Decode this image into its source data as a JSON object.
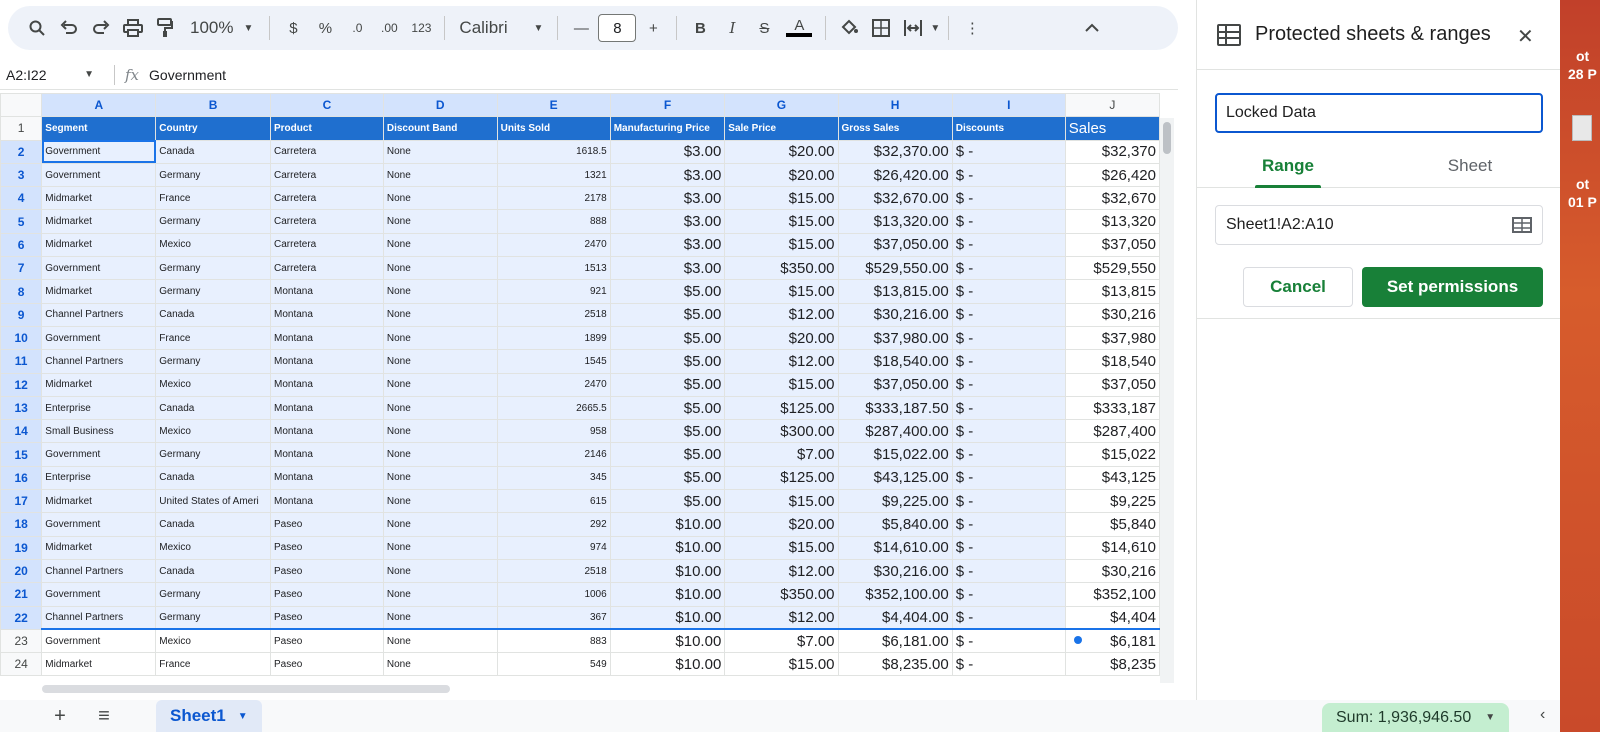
{
  "toolbar": {
    "zoom": "100%",
    "currency": "$",
    "percent": "%",
    "dec_decrease": ".0",
    "dec_increase": ".00",
    "number_format": "123",
    "font": "Calibri",
    "font_size": "8",
    "bold": "B",
    "italic": "I",
    "strike": "S",
    "text_color": "A"
  },
  "formula_bar": {
    "name_box": "A2:I22",
    "fx": "fx",
    "value": "Government"
  },
  "grid": {
    "columns": [
      "A",
      "B",
      "C",
      "D",
      "E",
      "F",
      "G",
      "H",
      "I",
      "J"
    ],
    "header_row": [
      "Segment",
      "Country",
      "Product",
      "Discount Band",
      "Units Sold",
      "Manufacturing Price",
      "Sale Price",
      "Gross Sales",
      "Discounts",
      "Sales"
    ],
    "rows": [
      {
        "n": "2",
        "c": [
          "Government",
          "Canada",
          "Carretera",
          "None",
          "1618.5",
          "$3.00",
          "$20.00",
          "$32,370.00",
          "$ -",
          "$32,370"
        ]
      },
      {
        "n": "3",
        "c": [
          "Government",
          "Germany",
          "Carretera",
          "None",
          "1321",
          "$3.00",
          "$20.00",
          "$26,420.00",
          "$ -",
          "$26,420"
        ]
      },
      {
        "n": "4",
        "c": [
          "Midmarket",
          "France",
          "Carretera",
          "None",
          "2178",
          "$3.00",
          "$15.00",
          "$32,670.00",
          "$ -",
          "$32,670"
        ]
      },
      {
        "n": "5",
        "c": [
          "Midmarket",
          "Germany",
          "Carretera",
          "None",
          "888",
          "$3.00",
          "$15.00",
          "$13,320.00",
          "$ -",
          "$13,320"
        ]
      },
      {
        "n": "6",
        "c": [
          "Midmarket",
          "Mexico",
          "Carretera",
          "None",
          "2470",
          "$3.00",
          "$15.00",
          "$37,050.00",
          "$ -",
          "$37,050"
        ]
      },
      {
        "n": "7",
        "c": [
          "Government",
          "Germany",
          "Carretera",
          "None",
          "1513",
          "$3.00",
          "$350.00",
          "$529,550.00",
          "$ -",
          "$529,550"
        ]
      },
      {
        "n": "8",
        "c": [
          "Midmarket",
          "Germany",
          "Montana",
          "None",
          "921",
          "$5.00",
          "$15.00",
          "$13,815.00",
          "$ -",
          "$13,815"
        ]
      },
      {
        "n": "9",
        "c": [
          "Channel Partners",
          "Canada",
          "Montana",
          "None",
          "2518",
          "$5.00",
          "$12.00",
          "$30,216.00",
          "$ -",
          "$30,216"
        ]
      },
      {
        "n": "10",
        "c": [
          "Government",
          "France",
          "Montana",
          "None",
          "1899",
          "$5.00",
          "$20.00",
          "$37,980.00",
          "$ -",
          "$37,980"
        ]
      },
      {
        "n": "11",
        "c": [
          "Channel Partners",
          "Germany",
          "Montana",
          "None",
          "1545",
          "$5.00",
          "$12.00",
          "$18,540.00",
          "$ -",
          "$18,540"
        ]
      },
      {
        "n": "12",
        "c": [
          "Midmarket",
          "Mexico",
          "Montana",
          "None",
          "2470",
          "$5.00",
          "$15.00",
          "$37,050.00",
          "$ -",
          "$37,050"
        ]
      },
      {
        "n": "13",
        "c": [
          "Enterprise",
          "Canada",
          "Montana",
          "None",
          "2665.5",
          "$5.00",
          "$125.00",
          "$333,187.50",
          "$ -",
          "$333,187"
        ]
      },
      {
        "n": "14",
        "c": [
          "Small Business",
          "Mexico",
          "Montana",
          "None",
          "958",
          "$5.00",
          "$300.00",
          "$287,400.00",
          "$ -",
          "$287,400"
        ]
      },
      {
        "n": "15",
        "c": [
          "Government",
          "Germany",
          "Montana",
          "None",
          "2146",
          "$5.00",
          "$7.00",
          "$15,022.00",
          "$ -",
          "$15,022"
        ]
      },
      {
        "n": "16",
        "c": [
          "Enterprise",
          "Canada",
          "Montana",
          "None",
          "345",
          "$5.00",
          "$125.00",
          "$43,125.00",
          "$ -",
          "$43,125"
        ]
      },
      {
        "n": "17",
        "c": [
          "Midmarket",
          "United States of Ameri",
          "Montana",
          "None",
          "615",
          "$5.00",
          "$15.00",
          "$9,225.00",
          "$ -",
          "$9,225"
        ]
      },
      {
        "n": "18",
        "c": [
          "Government",
          "Canada",
          "Paseo",
          "None",
          "292",
          "$10.00",
          "$20.00",
          "$5,840.00",
          "$ -",
          "$5,840"
        ]
      },
      {
        "n": "19",
        "c": [
          "Midmarket",
          "Mexico",
          "Paseo",
          "None",
          "974",
          "$10.00",
          "$15.00",
          "$14,610.00",
          "$ -",
          "$14,610"
        ]
      },
      {
        "n": "20",
        "c": [
          "Channel Partners",
          "Canada",
          "Paseo",
          "None",
          "2518",
          "$10.00",
          "$12.00",
          "$30,216.00",
          "$ -",
          "$30,216"
        ]
      },
      {
        "n": "21",
        "c": [
          "Government",
          "Germany",
          "Paseo",
          "None",
          "1006",
          "$10.00",
          "$350.00",
          "$352,100.00",
          "$ -",
          "$352,100"
        ]
      },
      {
        "n": "22",
        "c": [
          "Channel Partners",
          "Germany",
          "Paseo",
          "None",
          "367",
          "$10.00",
          "$12.00",
          "$4,404.00",
          "$ -",
          "$4,404"
        ]
      },
      {
        "n": "23",
        "c": [
          "Government",
          "Mexico",
          "Paseo",
          "None",
          "883",
          "$10.00",
          "$7.00",
          "$6,181.00",
          "$ -",
          "$6,181"
        ]
      },
      {
        "n": "24",
        "c": [
          "Midmarket",
          "France",
          "Paseo",
          "None",
          "549",
          "$10.00",
          "$15.00",
          "$8,235.00",
          "$ -",
          "$8,235"
        ]
      }
    ]
  },
  "bottom": {
    "sheet_name": "Sheet1",
    "sum": "Sum: 1,936,946.50"
  },
  "panel": {
    "title": "Protected sheets & ranges",
    "description_value": "Locked Data",
    "tab_range": "Range",
    "tab_sheet": "Sheet",
    "range_value": "Sheet1!A2:A10",
    "cancel_label": "Cancel",
    "set_permissions_label": "Set permissions"
  },
  "desktop": {
    "label1": "ot",
    "label2": "28 P",
    "label3": "ot",
    "label4": "01 P"
  },
  "colors": {
    "header_blue": "#1f6fcf",
    "selection": "#e8f0fe",
    "accent_green": "#188038",
    "sum_chip": "#c4eed0"
  }
}
